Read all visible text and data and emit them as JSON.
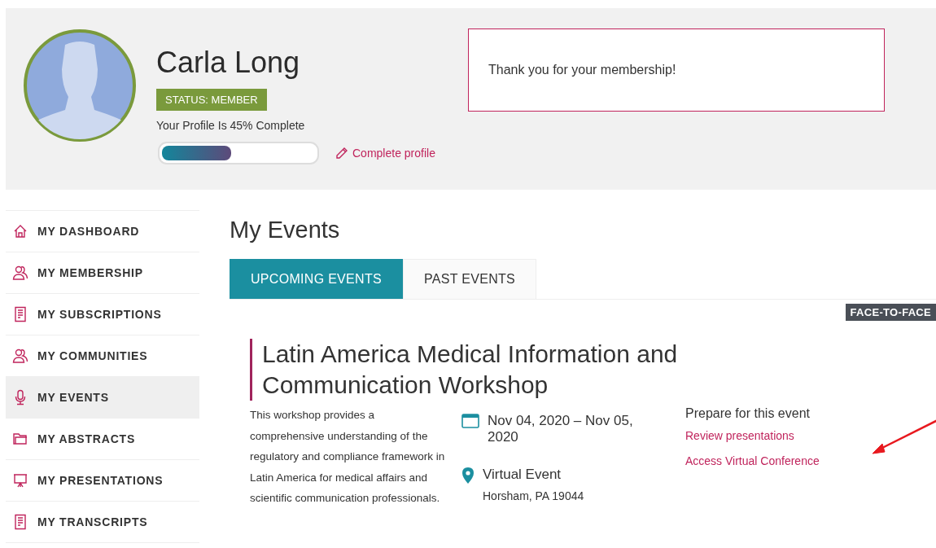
{
  "profile": {
    "name": "Carla Long",
    "status": "STATUS: MEMBER",
    "completion_text": "Your Profile Is 45% Complete",
    "level": 0.45,
    "complete_link": "Complete profile"
  },
  "notice": {
    "message": "Thank you for your membership!"
  },
  "sidebar": {
    "items": [
      {
        "label": "MY DASHBOARD",
        "kind": "home",
        "selected": false
      },
      {
        "label": "MY MEMBERSHIP",
        "kind": "people",
        "selected": false
      },
      {
        "label": "MY SUBSCRIPTIONS",
        "kind": "document",
        "selected": false
      },
      {
        "label": "MY COMMUNITIES",
        "kind": "people",
        "selected": false
      },
      {
        "label": "MY EVENTS",
        "kind": "microphone",
        "selected": true
      },
      {
        "label": "MY ABSTRACTS",
        "kind": "folder",
        "selected": false
      },
      {
        "label": "MY PRESENTATIONS",
        "kind": "easel",
        "selected": false
      },
      {
        "label": "MY TRANSCRIPTS",
        "kind": "document",
        "selected": false
      }
    ]
  },
  "page_title": "My Events",
  "tabs": [
    {
      "label": "UPCOMING EVENTS",
      "selected": true
    },
    {
      "label": "PAST EVENTS",
      "selected": false
    }
  ],
  "event": {
    "badge": "FACE-TO-FACE",
    "title": "Latin America Medical Information and Communication Workshop",
    "description": "This workshop provides a comprehensive understanding of the regulatory and compliance framework in Latin America for medical affairs and scientific communication professionals.",
    "dates": "Nov 04, 2020 – Nov 05, 2020",
    "location": "Virtual Event",
    "address": "Horsham, PA 19044",
    "prepare_heading": "Prepare for this event",
    "links": [
      "Review presentations",
      "Access Virtual Conference"
    ]
  }
}
